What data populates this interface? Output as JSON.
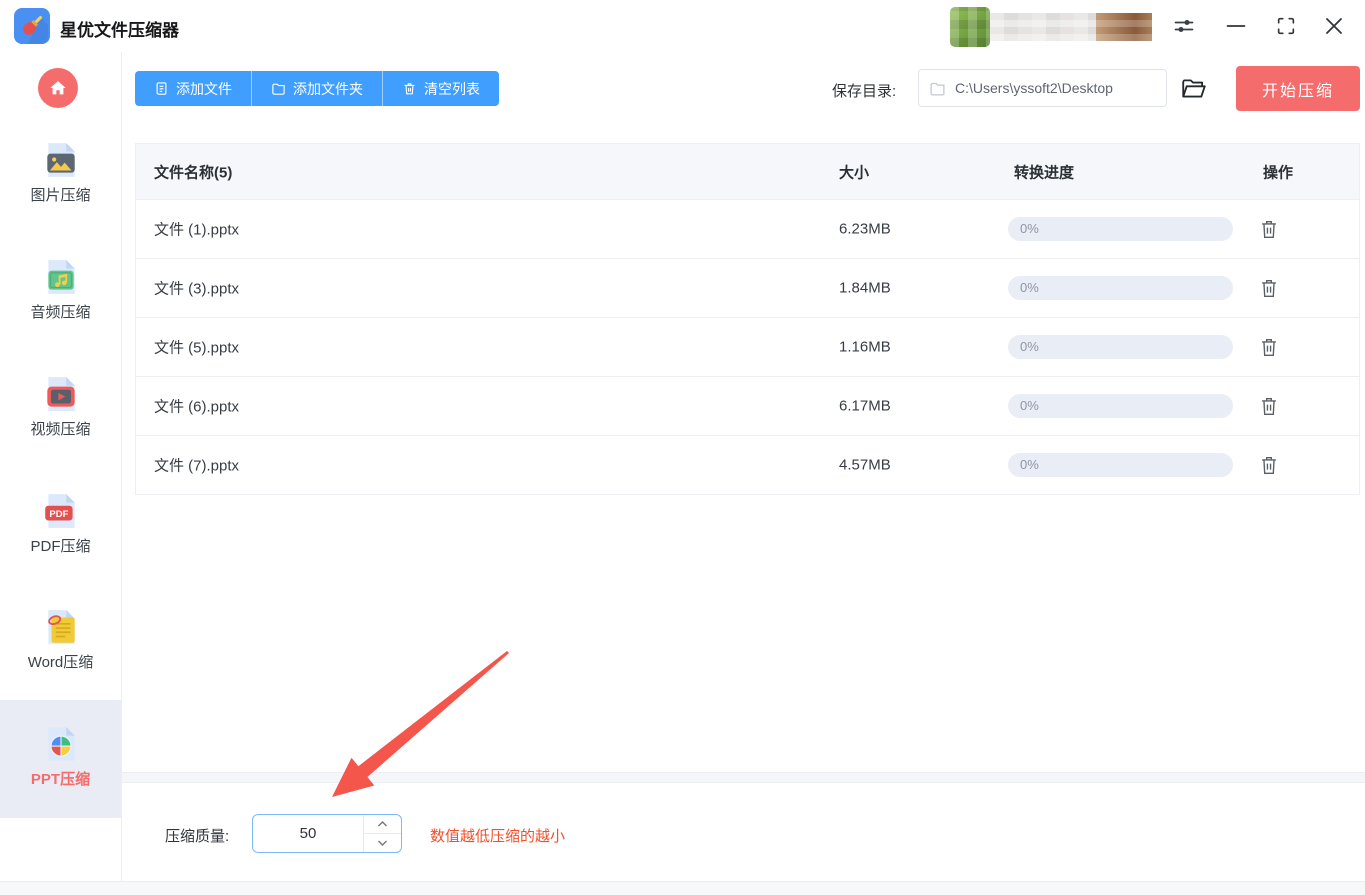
{
  "app": {
    "title": "星优文件压缩器"
  },
  "titlebar": {
    "icons": [
      "settings-sliders",
      "minimize",
      "maximize",
      "close"
    ]
  },
  "sidebar": {
    "home": "home",
    "items": [
      {
        "label": "图片压缩",
        "icon": "image-file-icon",
        "active": false
      },
      {
        "label": "音频压缩",
        "icon": "audio-file-icon",
        "active": false
      },
      {
        "label": "视频压缩",
        "icon": "video-file-icon",
        "active": false
      },
      {
        "label": "PDF压缩",
        "icon": "pdf-file-icon",
        "active": false
      },
      {
        "label": "Word压缩",
        "icon": "word-file-icon",
        "active": false
      },
      {
        "label": "PPT压缩",
        "icon": "ppt-file-icon",
        "active": true
      }
    ]
  },
  "toolbar": {
    "add_file": "添加文件",
    "add_folder": "添加文件夹",
    "clear_list": "清空列表"
  },
  "save": {
    "label": "保存目录:",
    "path": "C:\\Users\\yssoft2\\Desktop",
    "start": "开始压缩"
  },
  "table": {
    "headers": {
      "name": "文件名称(5)",
      "size": "大小",
      "progress": "转换进度",
      "action": "操作"
    },
    "rows": [
      {
        "name": "文件 (1).pptx",
        "size": "6.23MB",
        "progress": "0%"
      },
      {
        "name": "文件 (3).pptx",
        "size": "1.84MB",
        "progress": "0%"
      },
      {
        "name": "文件 (5).pptx",
        "size": "1.16MB",
        "progress": "0%"
      },
      {
        "name": "文件 (6).pptx",
        "size": "6.17MB",
        "progress": "0%"
      },
      {
        "name": "文件 (7).pptx",
        "size": "4.57MB",
        "progress": "0%"
      }
    ]
  },
  "quality": {
    "label": "压缩质量:",
    "value": "50",
    "hint": "数值越低压缩的越小"
  },
  "colors": {
    "primary": "#409eff",
    "danger": "#f56c6c",
    "hint_text": "#f2502b",
    "progress_track": "#e9edf6",
    "sidebar_active_bg": "#e9ecf4",
    "header_bg": "#f5f7fa",
    "arrow": "#f4564c"
  }
}
